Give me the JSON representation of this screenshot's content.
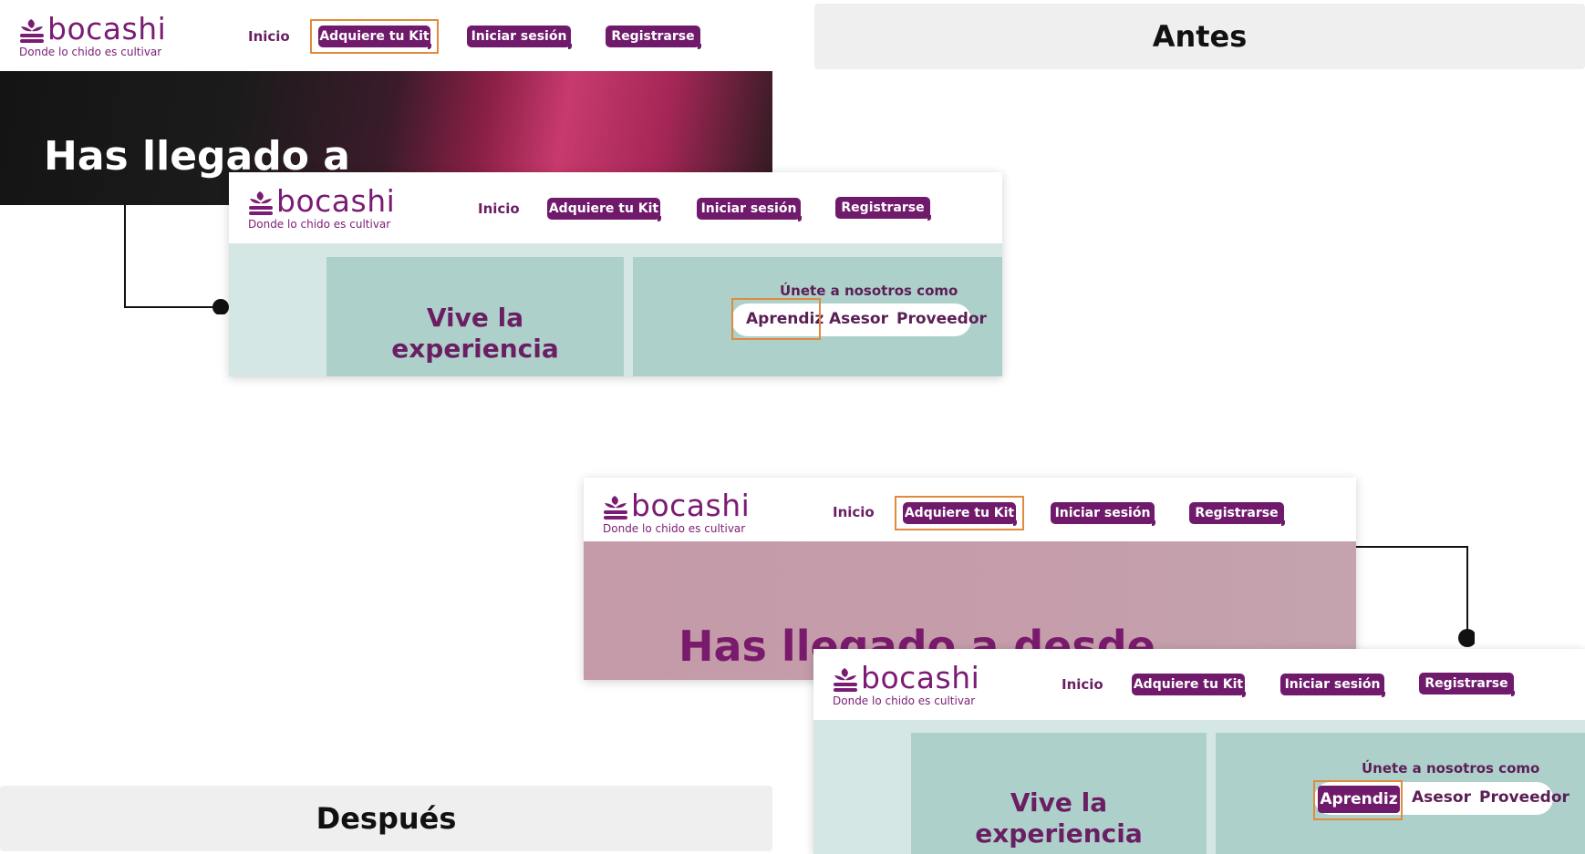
{
  "labels": {
    "before": "Antes",
    "after": "Después"
  },
  "brand": {
    "name": "bocashi",
    "tagline": "Donde lo chido es cultivar"
  },
  "nav": {
    "home": "Inicio",
    "kit": "Adquiere tu Kit",
    "login": "Iniciar sesión",
    "register": "Registrarse"
  },
  "hero": {
    "title_before": "Has llegado a",
    "title_after": "Has llegado a desde"
  },
  "experience": {
    "title": "Vive la experiencia",
    "join_prompt": "Únete a nosotros como",
    "roles": [
      "Aprendiz",
      "Asesor",
      "Proveedor"
    ]
  },
  "colors": {
    "brand_purple": "#701a6c",
    "highlight_orange": "#e08a3c",
    "teal_panel": "#aed0cb",
    "label_bg": "#efefef"
  }
}
